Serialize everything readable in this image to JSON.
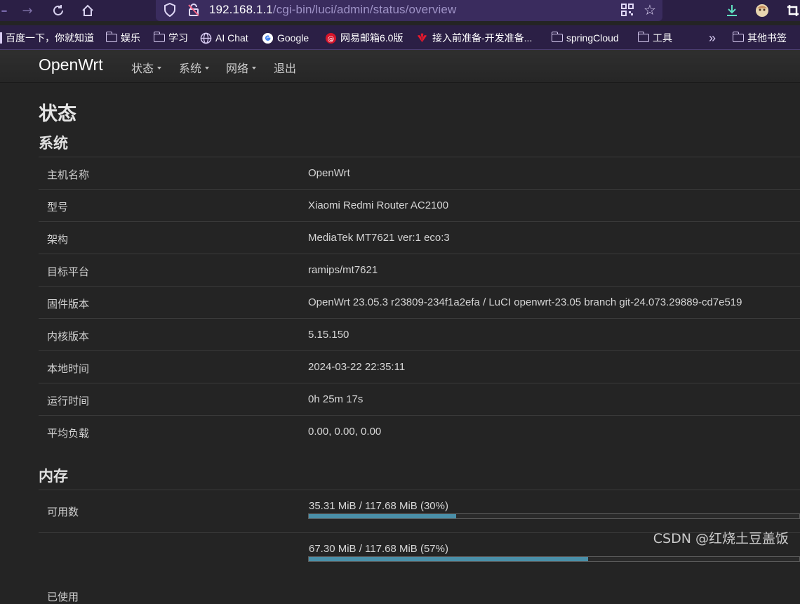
{
  "browser": {
    "url_host": "192.168.1.1",
    "url_path": "/cgi-bin/luci/admin/status/overview",
    "bookmarks": [
      {
        "label": "百度一下，你就知道",
        "icon": "bookmark-icon"
      },
      {
        "label": "娱乐",
        "icon": "folder-icon"
      },
      {
        "label": "学习",
        "icon": "folder-icon"
      },
      {
        "label": "AI Chat",
        "icon": "globe-icon"
      },
      {
        "label": "Google",
        "icon": "google-icon"
      },
      {
        "label": "网易邮箱6.0版",
        "icon": "netease-icon"
      },
      {
        "label": "接入前准备-开发准备...",
        "icon": "huawei-icon"
      },
      {
        "label": "springCloud",
        "icon": "folder-icon"
      },
      {
        "label": "工具",
        "icon": "folder-icon"
      },
      {
        "label": "其他书签",
        "icon": "folder-icon"
      }
    ]
  },
  "header": {
    "brand": "OpenWrt",
    "menu": [
      {
        "label": "状态",
        "has_dropdown": true
      },
      {
        "label": "系统",
        "has_dropdown": true
      },
      {
        "label": "网络",
        "has_dropdown": true
      },
      {
        "label": "退出",
        "has_dropdown": false
      }
    ]
  },
  "page": {
    "title": "状态",
    "system_section": "系统",
    "memory_section": "内存"
  },
  "system": [
    {
      "key": "主机名称",
      "value": "OpenWrt"
    },
    {
      "key": "型号",
      "value": "Xiaomi Redmi Router AC2100"
    },
    {
      "key": "架构",
      "value": "MediaTek MT7621 ver:1 eco:3"
    },
    {
      "key": "目标平台",
      "value": "ramips/mt7621"
    },
    {
      "key": "固件版本",
      "value": "OpenWrt 23.05.3 r23809-234f1a2efa / LuCI openwrt-23.05 branch git-24.073.29889-cd7e519"
    },
    {
      "key": "内核版本",
      "value": "5.15.150"
    },
    {
      "key": "本地时间",
      "value": "2024-03-22 22:35:11"
    },
    {
      "key": "运行时间",
      "value": "0h 25m 17s"
    },
    {
      "key": "平均负载",
      "value": "0.00, 0.00, 0.00"
    }
  ],
  "memory": [
    {
      "key": "可用数",
      "label": "35.31 MiB / 117.68 MiB (30%)",
      "percent": 30
    },
    {
      "key": "已使用",
      "label": "67.30 MiB / 117.68 MiB (57%)",
      "percent": 57
    }
  ],
  "watermark": "CSDN @红烧土豆盖饭",
  "colors": {
    "bar_fill": "#4a8fa8",
    "toolbar": "#2b1f45",
    "background": "#242424"
  }
}
